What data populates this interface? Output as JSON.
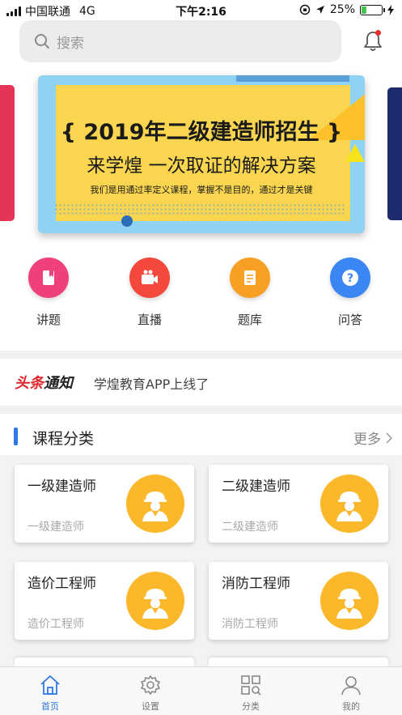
{
  "status_bar": {
    "carrier": "中国联通",
    "network": "4G",
    "time": "下午2:16",
    "battery": "25%",
    "battery_level": 0.25
  },
  "search": {
    "placeholder": "搜索"
  },
  "banner": {
    "title": "{ 2019年二级建造师招生 }",
    "subtitle": "来学煌 一次取证的解决方案",
    "tagline": "我们是用通过率定义课程，掌握不是目的，通过才是关键"
  },
  "quick_nav": [
    {
      "label": "讲题",
      "icon": "book-icon",
      "color": "#f0407a"
    },
    {
      "label": "直播",
      "icon": "video-camera-icon",
      "color": "#f5483c"
    },
    {
      "label": "题库",
      "icon": "notebook-icon",
      "color": "#f7a023"
    },
    {
      "label": "问答",
      "icon": "question-icon",
      "color": "#3b86f2"
    }
  ],
  "notice": {
    "tag_part1": "头条",
    "tag_part2": "通知",
    "text": "学煌教育APP上线了"
  },
  "section": {
    "title": "课程分类",
    "more": "更多"
  },
  "courses": [
    {
      "title": "一级建造师",
      "subtitle": "一级建造师"
    },
    {
      "title": "二级建造师",
      "subtitle": "二级建造师"
    },
    {
      "title": "造价工程师",
      "subtitle": "造价工程师"
    },
    {
      "title": "消防工程师",
      "subtitle": "消防工程师"
    }
  ],
  "tabs": [
    {
      "label": "首页",
      "icon": "home-icon",
      "active": true
    },
    {
      "label": "设置",
      "icon": "gear-icon",
      "active": false
    },
    {
      "label": "分类",
      "icon": "category-icon",
      "active": false
    },
    {
      "label": "我的",
      "icon": "user-icon",
      "active": false
    }
  ],
  "colors": {
    "accent": "#2f78e8",
    "notice_red": "#e0252b",
    "avatar_yellow": "#fbb82a"
  }
}
